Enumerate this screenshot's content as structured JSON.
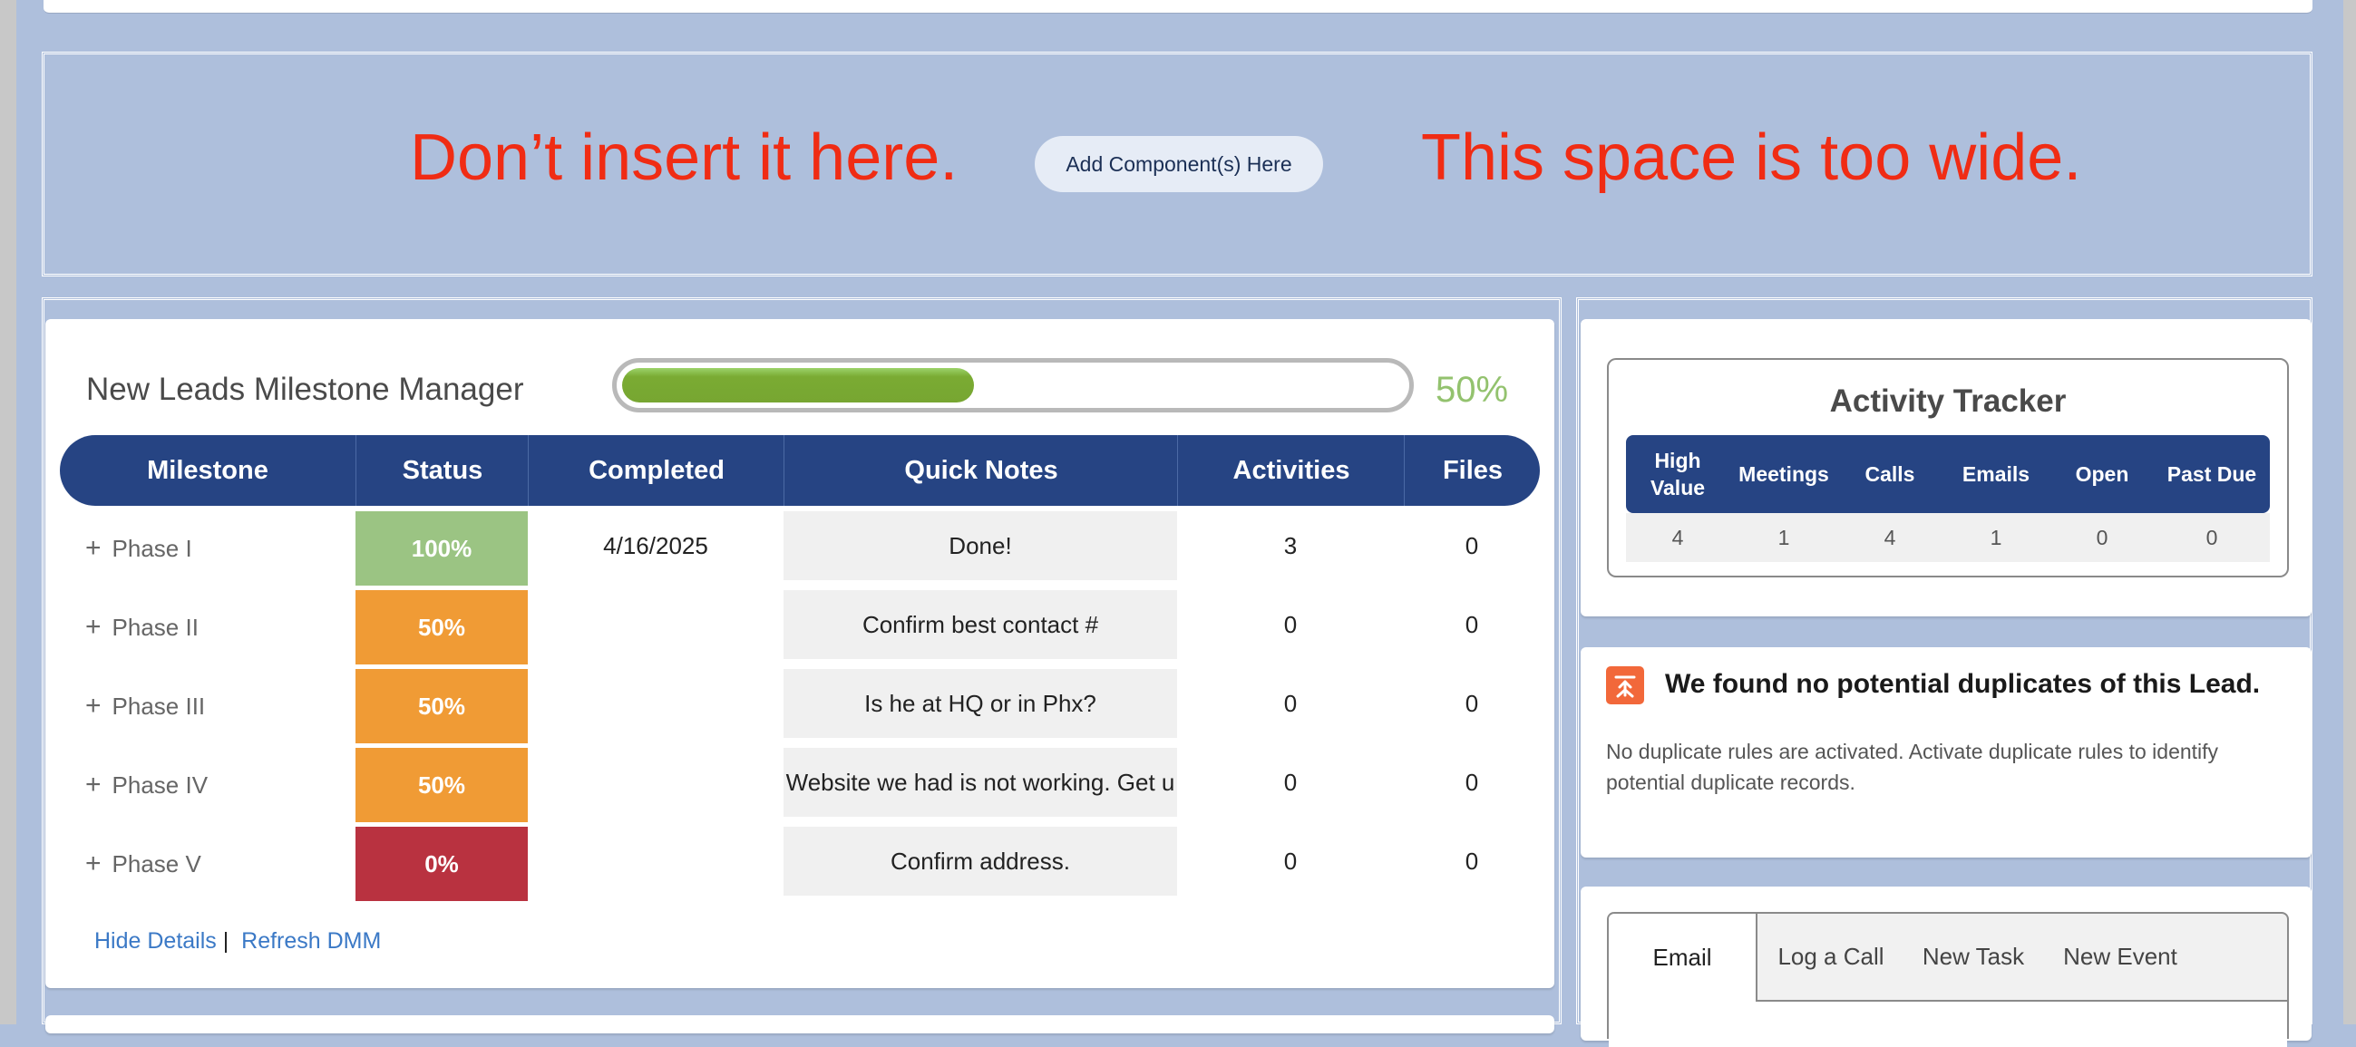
{
  "dropzone": {
    "warning_left": "Don’t insert it here.",
    "button_label": "Add Component(s) Here",
    "warning_right": "This space is too wide."
  },
  "dmm": {
    "title": "New Leads Milestone Manager",
    "progress_percent": 50,
    "progress_label": "50%",
    "columns": [
      "Milestone",
      "Status",
      "Completed",
      "Quick Notes",
      "Activities",
      "Files"
    ],
    "rows": [
      {
        "phase": "Phase I",
        "status": "100%",
        "status_color": "#9bc483",
        "completed": "4/16/2025",
        "note": "Done!",
        "activities": "3",
        "files": "0"
      },
      {
        "phase": "Phase II",
        "status": "50%",
        "status_color": "#f09b35",
        "completed": "",
        "note": "Confirm best contact #",
        "activities": "0",
        "files": "0"
      },
      {
        "phase": "Phase III",
        "status": "50%",
        "status_color": "#f09b35",
        "completed": "",
        "note": "Is he at HQ or in Phx?",
        "activities": "0",
        "files": "0"
      },
      {
        "phase": "Phase IV",
        "status": "50%",
        "status_color": "#f09b35",
        "completed": "",
        "note": "Website we had is not working. Get u",
        "activities": "0",
        "files": "0"
      },
      {
        "phase": "Phase V",
        "status": "0%",
        "status_color": "#b93240",
        "completed": "",
        "note": "Confirm address.",
        "activities": "0",
        "files": "0"
      }
    ],
    "links": {
      "hide_details": "Hide Details",
      "separator": "|",
      "refresh": "Refresh DMM"
    }
  },
  "activity_tracker": {
    "title": "Activity Tracker",
    "headers": [
      "High Value",
      "Meetings",
      "Calls",
      "Emails",
      "Open",
      "Past Due"
    ],
    "values": [
      "4",
      "1",
      "4",
      "1",
      "0",
      "0"
    ]
  },
  "duplicates": {
    "title": "We found no potential duplicates of this Lead.",
    "body": "No duplicate rules are activated. Activate duplicate rules to identify potential duplicate records."
  },
  "composer": {
    "tabs": [
      "Email",
      "Log a Call",
      "New Task",
      "New Event"
    ],
    "active_tab": "Email"
  },
  "colors": {
    "header_navy": "#264483",
    "progress_green": "#77a631",
    "warning_red": "#f02c14",
    "link_blue": "#3b79c6",
    "page_bg": "#aebfdc"
  }
}
